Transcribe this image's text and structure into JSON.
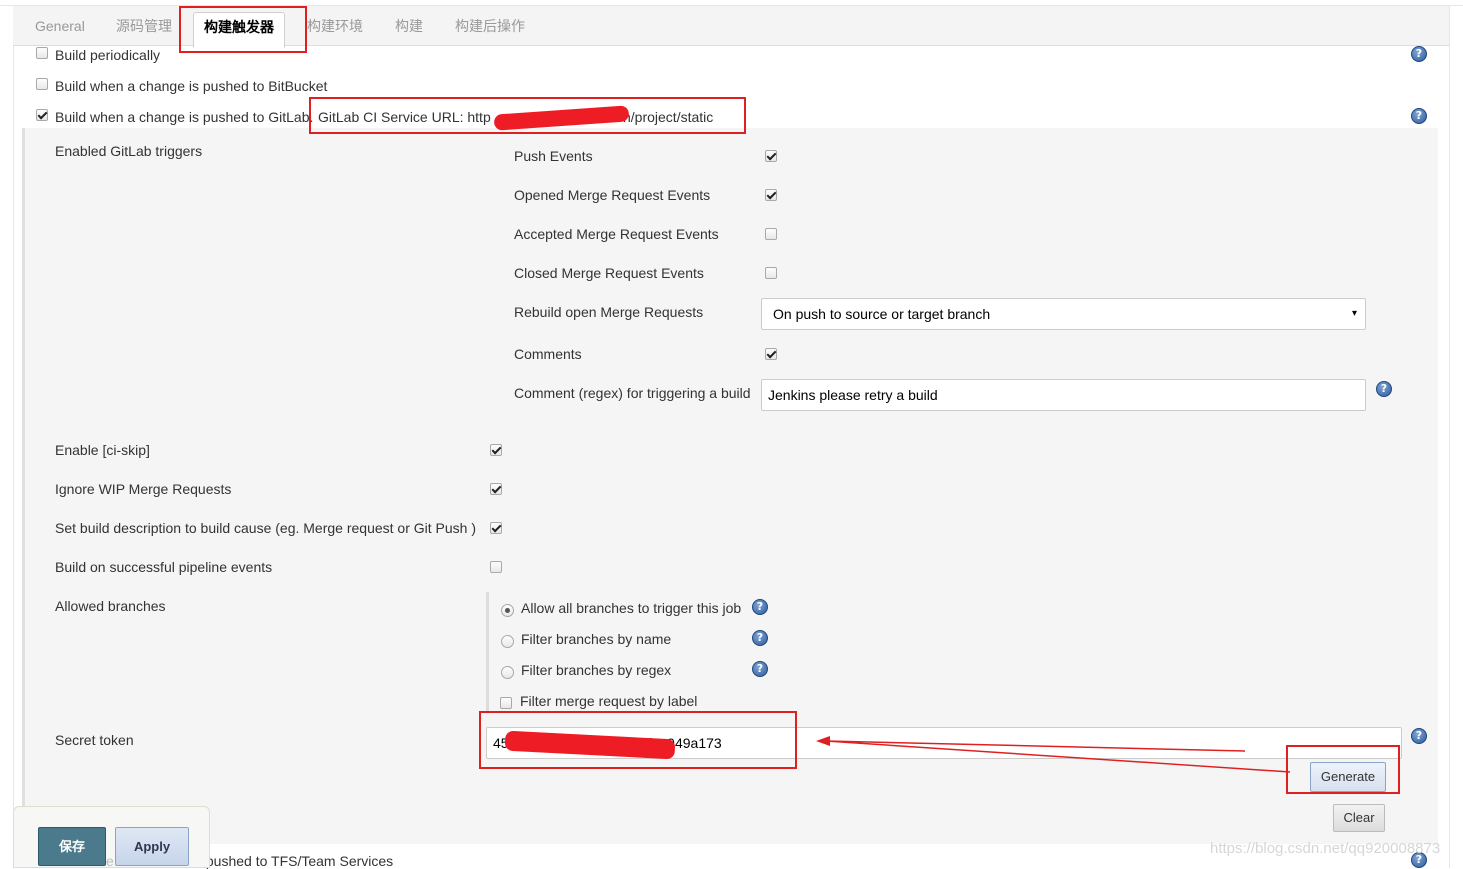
{
  "tabs": [
    "General",
    "源码管理",
    "构建触发器",
    "构建环境",
    "构建",
    "构建后操作"
  ],
  "triggers": {
    "build_periodically": "Build periodically",
    "bitbucket": "Build when a change is pushed to BitBucket",
    "gitlab": "Build when a change is pushed to GitLab.",
    "gitlab_url": "GitLab CI Service URL: http",
    "gitlab_url_suffix": "n/project/static"
  },
  "gitlab": {
    "enabled_triggers_label": "Enabled GitLab triggers",
    "events": [
      {
        "label": "Push Events",
        "checked": true
      },
      {
        "label": "Opened Merge Request Events",
        "checked": true
      },
      {
        "label": "Accepted Merge Request Events",
        "checked": false
      },
      {
        "label": "Closed Merge Request Events",
        "checked": false
      }
    ],
    "rebuild_label": "Rebuild open Merge Requests",
    "rebuild_value": "On push to source or target branch",
    "comments_label": "Comments",
    "comment_regex_label": "Comment (regex) for triggering a build",
    "comment_regex_value": "Jenkins please retry a build",
    "ci_skip": "Enable [ci-skip]",
    "ignore_wip": "Ignore WIP Merge Requests",
    "set_desc": "Set build description to build cause (eg. Merge request or Git Push )",
    "pipeline": "Build on successful pipeline events",
    "allowed_branches_label": "Allowed branches",
    "branch_options": [
      "Allow all branches to trigger this job",
      "Filter branches by name",
      "Filter branches by regex"
    ],
    "merge_label": "Filter merge request by label",
    "secret_token_label": "Secret token",
    "secret_token_prefix": "450a0",
    "secret_token_suffix": "0f1a949a173",
    "generate_label": "Generate",
    "clear_label": "Clear"
  },
  "footer": {
    "save_label": "保存",
    "apply_label": "Apply",
    "tfs_partial": "e",
    "tfs_tail": "s pushed to TFS/Team Services"
  },
  "watermark": "https://blog.csdn.net/qq920008873",
  "help_glyph": "?",
  "dropdown_arrow": "▾",
  "colors": {
    "annotation_red": "#e02020",
    "help_blue": "#2d5a9b",
    "save_bg": "#4a7a8c"
  }
}
